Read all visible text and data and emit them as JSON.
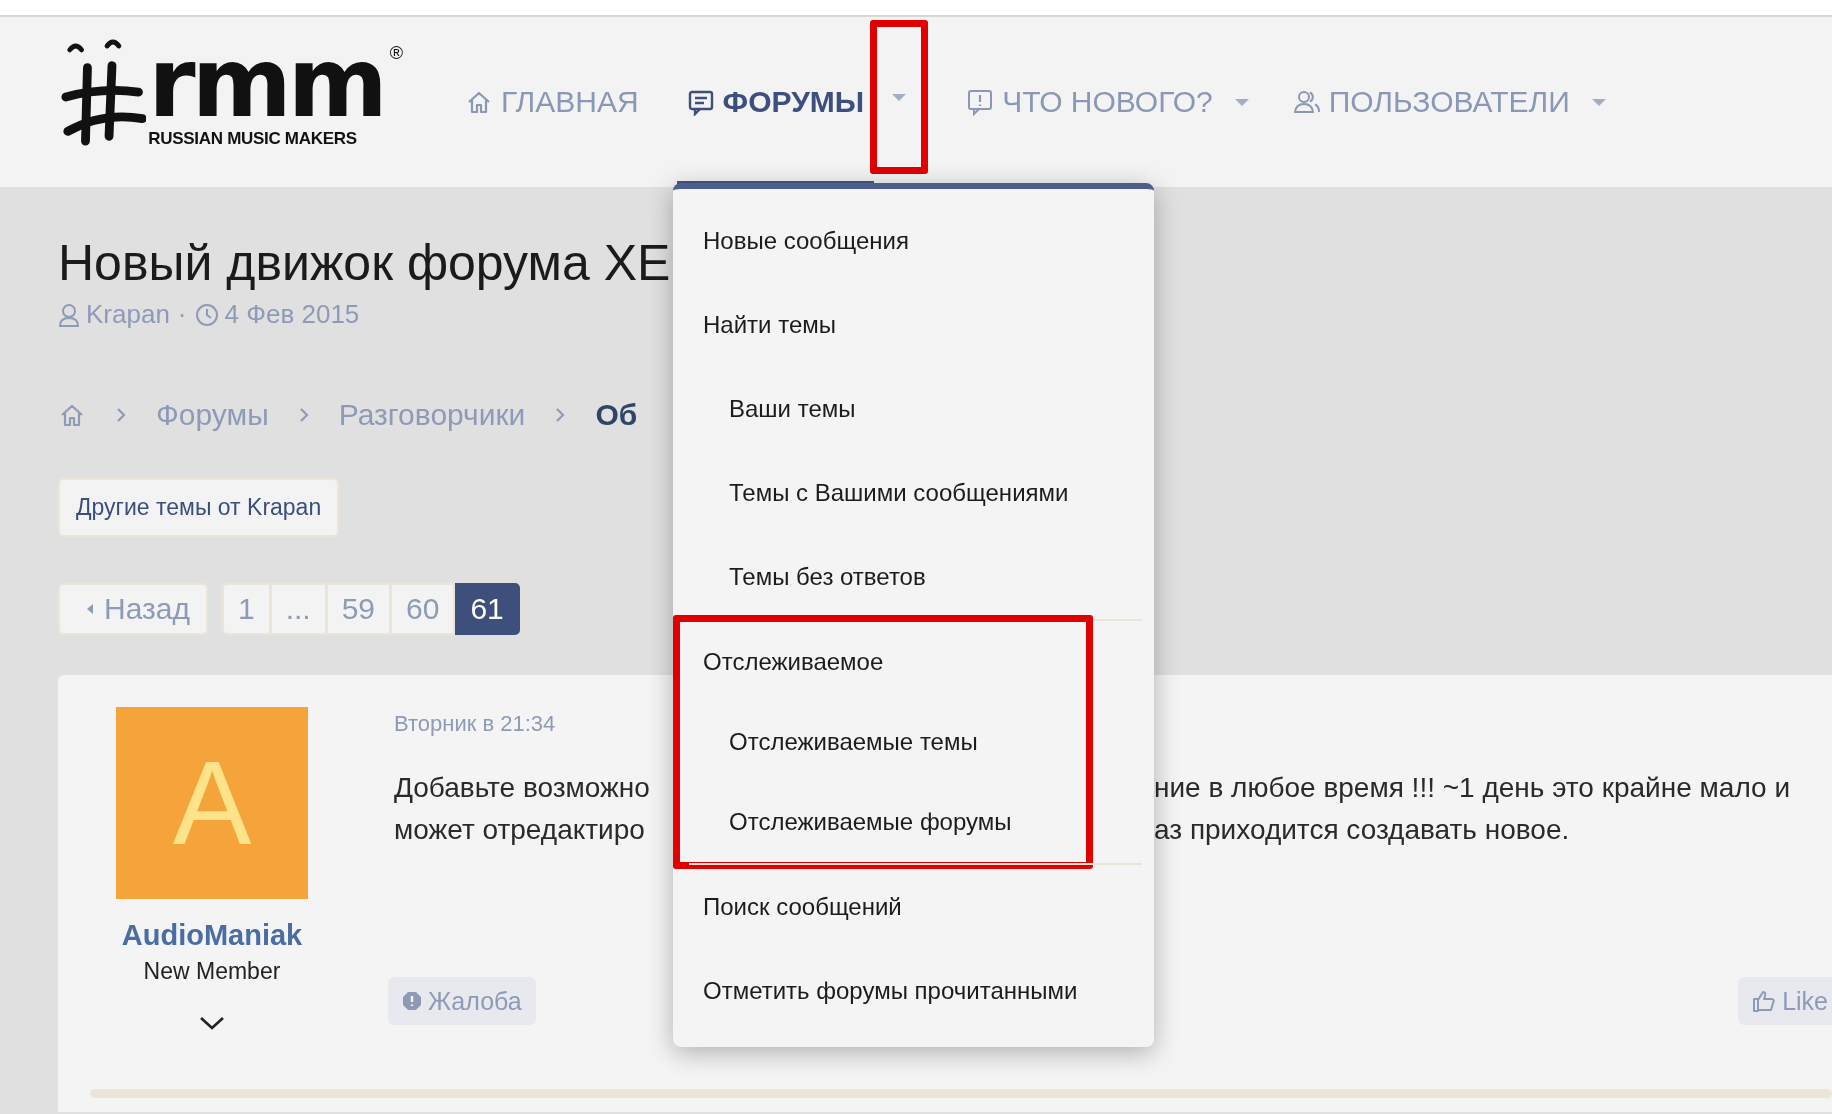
{
  "logo": {
    "mark": "rmm",
    "registered": "®",
    "tagline": "RUSSIAN MUSIC MAKERS"
  },
  "nav": {
    "items": [
      {
        "label": "ГЛАВНАЯ",
        "selected": false,
        "has_menu": false,
        "caret_highlighted": false
      },
      {
        "label": "ФОРУМЫ",
        "selected": true,
        "has_menu": true,
        "caret_highlighted": true
      },
      {
        "label": "ЧТО НОВОГО?",
        "selected": false,
        "has_menu": true,
        "caret_highlighted": false
      },
      {
        "label": "ПОЛЬЗОВАТЕЛИ",
        "selected": false,
        "has_menu": true,
        "caret_highlighted": false
      }
    ]
  },
  "dropdown": {
    "groups": [
      {
        "highlighted": false,
        "items": [
          {
            "label": "Новые сообщения"
          },
          {
            "label": "Найти темы",
            "children": [
              {
                "label": "Ваши темы"
              },
              {
                "label": "Темы с Вашими сообщениями"
              },
              {
                "label": "Темы без ответов"
              }
            ]
          }
        ]
      },
      {
        "highlighted": true,
        "items": [
          {
            "label": "Отслеживаемое",
            "children": [
              {
                "label": "Отслеживаемые темы"
              },
              {
                "label": "Отслеживаемые форумы"
              }
            ]
          }
        ]
      },
      {
        "highlighted": false,
        "items": [
          {
            "label": "Поиск сообщений"
          },
          {
            "label": "Отметить форумы прочитанными"
          }
        ]
      }
    ]
  },
  "thread": {
    "title": "Новый движок форума XE",
    "author": "Krapan",
    "separator": "·",
    "date": "4 Фев 2015"
  },
  "breadcrumbs": [
    {
      "label": "Форумы",
      "current": false
    },
    {
      "label": "Разговорчики",
      "current": false
    },
    {
      "label": "Об",
      "current": true
    }
  ],
  "other_threads_button": "Другие темы от Krapan",
  "pagination": {
    "prev": "Назад",
    "pages": [
      {
        "label": "1",
        "selected": false
      },
      {
        "label": "...",
        "selected": false
      },
      {
        "label": "59",
        "selected": false
      },
      {
        "label": "60",
        "selected": false
      },
      {
        "label": "61",
        "selected": true
      }
    ]
  },
  "post": {
    "avatar_letter": "A",
    "author": "AudioManiak",
    "role": "New Member",
    "date": "Вторник в 21:34",
    "body_lines": [
      {
        "left": "Добавьте возможно",
        "right": "ние в любое время !!! ~1 день это крайне мало и"
      },
      {
        "left": "может отредактиро",
        "right": "аз приходится создавать новое."
      }
    ],
    "report": "Жалоба",
    "like": "Like"
  }
}
